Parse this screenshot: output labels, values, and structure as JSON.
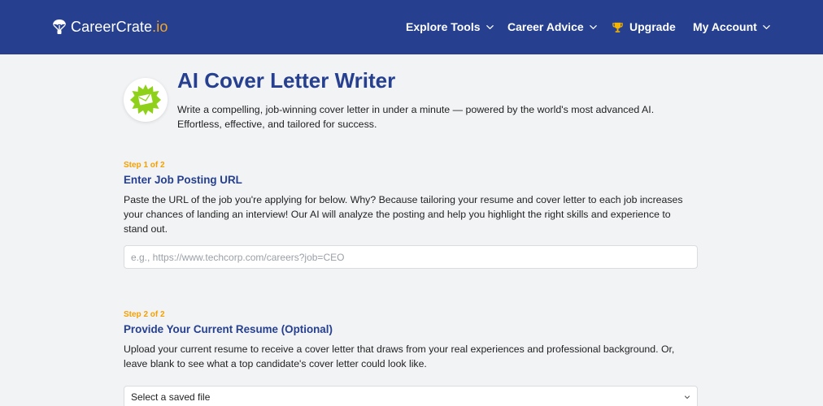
{
  "header": {
    "brand_name": "CareerCrate",
    "brand_tld": ".io",
    "nav": {
      "explore_tools": "Explore Tools",
      "career_advice": "Career Advice",
      "upgrade": "Upgrade",
      "my_account": "My Account"
    }
  },
  "hero": {
    "title": "AI Cover Letter Writer",
    "subtitle": "Write a compelling, job-winning cover letter in under a minute — powered by the world's most advanced AI. Effortless, effective, and tailored for success."
  },
  "step1": {
    "label": "Step 1 of 2",
    "heading": "Enter Job Posting URL",
    "description": "Paste the URL of the job you're applying for below. Why? Because tailoring your resume and cover letter to each job increases your chances of landing an interview! Our AI will analyze the posting and help you highlight the right skills and experience to stand out.",
    "url_value": "",
    "url_placeholder": "e.g., https://www.techcorp.com/careers?job=CEO"
  },
  "step2": {
    "label": "Step 2 of 2",
    "heading": "Provide Your Current Resume (Optional)",
    "description": "Upload your current resume to receive a cover letter that draws from your real experiences and professional background. Or, leave blank to see what a top candidate's cover letter could look like.",
    "file_select_value": "Select a saved file"
  },
  "colors": {
    "header_bg": "#26408f",
    "title_blue": "#26408f",
    "step_orange": "#f5a000",
    "brand_accent": "#f5a623",
    "page_bg": "#f2f3f5"
  },
  "icons": {
    "brand": "parachute-icon",
    "upgrade": "trophy-icon",
    "hero": "envelope-badge-icon",
    "dropdown": "chevron-down-icon"
  }
}
